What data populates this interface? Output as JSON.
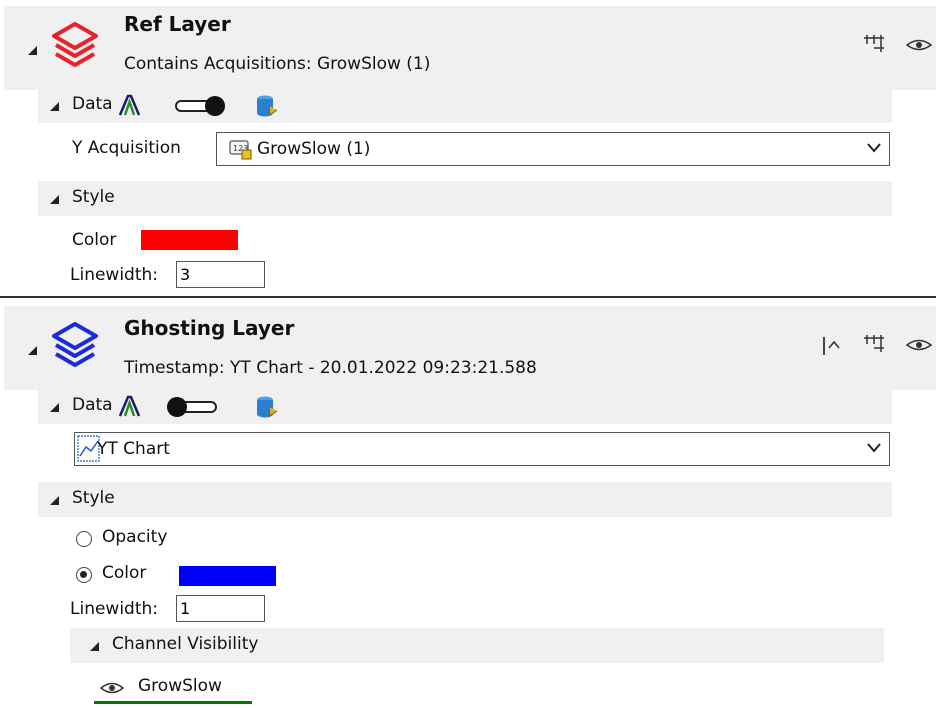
{
  "ref_layer": {
    "title": "Ref Layer",
    "subtitle": "Contains Acquisitions: GrowSlow (1)",
    "data_section": {
      "label": "Data",
      "toggle_on": false
    },
    "y_acquisition": {
      "label": "Y Acquisition",
      "value": "GrowSlow (1)"
    },
    "style_section": {
      "label": "Style"
    },
    "color": {
      "label": "Color",
      "value": "#ff0000"
    },
    "linewidth": {
      "label": "Linewidth:",
      "value": "3"
    }
  },
  "ghosting_layer": {
    "title": "Ghosting Layer",
    "subtitle": "Timestamp: YT Chart - 20.01.2022 09:23:21.588",
    "data_section": {
      "label": "Data",
      "toggle_on": true
    },
    "chart_select": {
      "value": "YT Chart"
    },
    "style_section": {
      "label": "Style"
    },
    "opacity_option": {
      "label": "Opacity",
      "selected": false
    },
    "color_option": {
      "label": "Color",
      "selected": true,
      "value": "#0000ff"
    },
    "linewidth": {
      "label": "Linewidth:",
      "value": "1"
    },
    "channel_visibility": {
      "label": "Channel Visibility",
      "channels": [
        {
          "name": "GrowSlow",
          "visible": true,
          "color": "#007a00"
        }
      ]
    }
  },
  "colors": {
    "ref_icon": "#e8222a",
    "ghost_icon": "#1a2bd8",
    "section_bg": "#f0f0f0",
    "selected_channel_underline": "#007a00"
  },
  "icons": [
    "layers-icon",
    "measure-icon",
    "eye-icon",
    "antenna-icon",
    "toggle-switch",
    "database-icon",
    "acquisition-icon",
    "line-chart-icon",
    "chevron-down-icon",
    "peak-cursor-icon"
  ]
}
